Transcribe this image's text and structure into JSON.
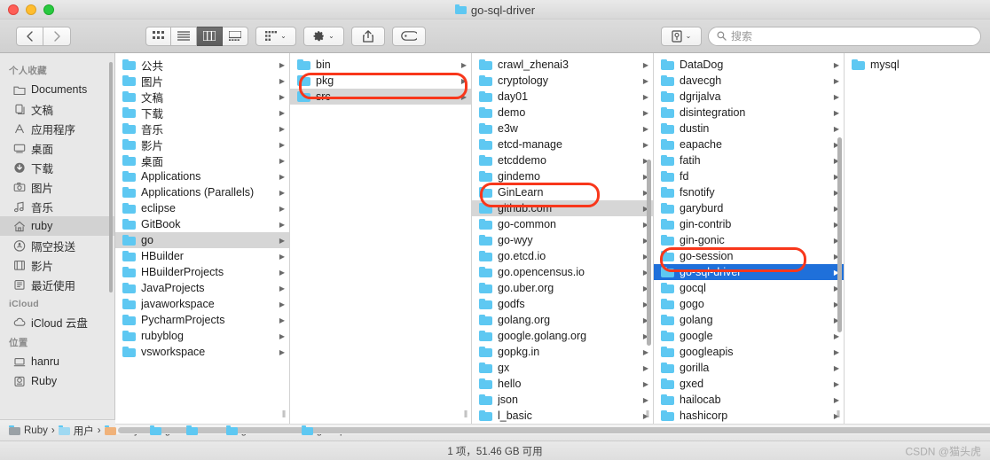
{
  "window": {
    "title": "go-sql-driver",
    "title_icon": "folder-icon"
  },
  "toolbar": {
    "back_label": "‹",
    "forward_label": "›",
    "view_icon_label": "icon-view-icon",
    "view_list_label": "list-view-icon",
    "view_column_label": "column-view-icon",
    "view_gallery_label": "gallery-view-icon",
    "arrange_label": "arrange-icon",
    "action_label": "gear-icon",
    "share_label": "share-icon",
    "tag_label": "tag-icon",
    "item_info_label": "item-info-icon",
    "chevron": "⌄",
    "search_placeholder": "搜索",
    "search_value": "",
    "active_view": "column"
  },
  "sidebar": {
    "sections": [
      {
        "header": "个人收藏",
        "items": [
          {
            "label": "Documents",
            "icon": "folder-icon",
            "selected": false
          },
          {
            "label": "文稿",
            "icon": "documents-icon",
            "selected": false
          },
          {
            "label": "应用程序",
            "icon": "applications-icon",
            "selected": false
          },
          {
            "label": "桌面",
            "icon": "desktop-icon",
            "selected": false
          },
          {
            "label": "下载",
            "icon": "downloads-icon",
            "selected": false
          },
          {
            "label": "图片",
            "icon": "pictures-icon",
            "selected": false
          },
          {
            "label": "音乐",
            "icon": "music-icon",
            "selected": false
          },
          {
            "label": "ruby",
            "icon": "home-icon",
            "selected": true
          },
          {
            "label": "隔空投送",
            "icon": "airdrop-icon",
            "selected": false
          },
          {
            "label": "影片",
            "icon": "movies-icon",
            "selected": false
          },
          {
            "label": "最近使用",
            "icon": "recents-icon",
            "selected": false
          }
        ]
      },
      {
        "header": "iCloud",
        "items": [
          {
            "label": "iCloud 云盘",
            "icon": "icloud-icon",
            "selected": false
          }
        ]
      },
      {
        "header": "位置",
        "items": [
          {
            "label": "hanru",
            "icon": "laptop-icon",
            "selected": false
          },
          {
            "label": "Ruby",
            "icon": "harddisk-icon",
            "selected": false
          }
        ]
      }
    ]
  },
  "columns": [
    {
      "name": "column-home",
      "items": [
        {
          "label": "公共",
          "icon": "public-folder-icon",
          "arrow": true,
          "state": "normal"
        },
        {
          "label": "图片",
          "icon": "pictures-folder-icon",
          "arrow": true,
          "state": "normal"
        },
        {
          "label": "文稿",
          "icon": "documents-folder-icon",
          "arrow": true,
          "state": "normal"
        },
        {
          "label": "下载",
          "icon": "downloads-folder-icon",
          "arrow": true,
          "state": "normal"
        },
        {
          "label": "音乐",
          "icon": "music-folder-icon",
          "arrow": true,
          "state": "normal"
        },
        {
          "label": "影片",
          "icon": "movies-folder-icon",
          "arrow": true,
          "state": "normal"
        },
        {
          "label": "桌面",
          "icon": "desktop-folder-icon",
          "arrow": true,
          "state": "normal"
        },
        {
          "label": "Applications",
          "icon": "applications-folder-icon",
          "arrow": true,
          "state": "normal"
        },
        {
          "label": "Applications (Parallels)",
          "icon": "parallels-folder-icon",
          "arrow": true,
          "state": "normal"
        },
        {
          "label": "eclipse",
          "icon": "folder-icon",
          "arrow": true,
          "state": "normal"
        },
        {
          "label": "GitBook",
          "icon": "folder-icon",
          "arrow": true,
          "state": "normal"
        },
        {
          "label": "go",
          "icon": "folder-icon",
          "arrow": true,
          "state": "grey"
        },
        {
          "label": "HBuilder",
          "icon": "folder-icon",
          "arrow": true,
          "state": "normal"
        },
        {
          "label": "HBuilderProjects",
          "icon": "folder-icon",
          "arrow": true,
          "state": "normal"
        },
        {
          "label": "JavaProjects",
          "icon": "folder-icon",
          "arrow": true,
          "state": "normal"
        },
        {
          "label": "javaworkspace",
          "icon": "folder-icon",
          "arrow": true,
          "state": "normal"
        },
        {
          "label": "PycharmProjects",
          "icon": "folder-icon",
          "arrow": true,
          "state": "normal"
        },
        {
          "label": "rubyblog",
          "icon": "folder-icon",
          "arrow": true,
          "state": "normal"
        },
        {
          "label": "vsworkspace",
          "icon": "folder-icon",
          "arrow": true,
          "state": "normal"
        }
      ]
    },
    {
      "name": "column-go",
      "items": [
        {
          "label": "bin",
          "icon": "folder-icon",
          "arrow": true,
          "state": "normal"
        },
        {
          "label": "pkg",
          "icon": "folder-icon",
          "arrow": true,
          "state": "normal"
        },
        {
          "label": "src",
          "icon": "folder-icon",
          "arrow": true,
          "state": "grey"
        }
      ]
    },
    {
      "name": "column-src",
      "items": [
        {
          "label": "crawl_zhenai3",
          "icon": "folder-icon",
          "arrow": true,
          "state": "normal"
        },
        {
          "label": "cryptology",
          "icon": "folder-icon",
          "arrow": true,
          "state": "normal"
        },
        {
          "label": "day01",
          "icon": "folder-icon",
          "arrow": true,
          "state": "normal"
        },
        {
          "label": "demo",
          "icon": "folder-icon",
          "arrow": true,
          "state": "normal"
        },
        {
          "label": "e3w",
          "icon": "folder-icon",
          "arrow": true,
          "state": "normal"
        },
        {
          "label": "etcd-manage",
          "icon": "folder-icon",
          "arrow": true,
          "state": "normal"
        },
        {
          "label": "etcddemo",
          "icon": "folder-icon",
          "arrow": true,
          "state": "normal"
        },
        {
          "label": "gindemo",
          "icon": "folder-icon",
          "arrow": true,
          "state": "normal"
        },
        {
          "label": "GinLearn",
          "icon": "folder-icon",
          "arrow": true,
          "state": "normal"
        },
        {
          "label": "github.com",
          "icon": "folder-icon",
          "arrow": true,
          "state": "grey"
        },
        {
          "label": "go-common",
          "icon": "folder-icon",
          "arrow": true,
          "state": "normal"
        },
        {
          "label": "go-wyy",
          "icon": "folder-icon",
          "arrow": true,
          "state": "normal"
        },
        {
          "label": "go.etcd.io",
          "icon": "folder-icon",
          "arrow": true,
          "state": "normal"
        },
        {
          "label": "go.opencensus.io",
          "icon": "folder-icon",
          "arrow": true,
          "state": "normal"
        },
        {
          "label": "go.uber.org",
          "icon": "folder-icon",
          "arrow": true,
          "state": "normal"
        },
        {
          "label": "godfs",
          "icon": "folder-icon",
          "arrow": true,
          "state": "normal"
        },
        {
          "label": "golang.org",
          "icon": "folder-icon",
          "arrow": true,
          "state": "normal"
        },
        {
          "label": "google.golang.org",
          "icon": "folder-icon",
          "arrow": true,
          "state": "normal"
        },
        {
          "label": "gopkg.in",
          "icon": "folder-icon",
          "arrow": true,
          "state": "normal"
        },
        {
          "label": "gx",
          "icon": "folder-icon",
          "arrow": true,
          "state": "normal"
        },
        {
          "label": "hello",
          "icon": "folder-icon",
          "arrow": true,
          "state": "normal"
        },
        {
          "label": "json",
          "icon": "folder-icon",
          "arrow": true,
          "state": "normal"
        },
        {
          "label": "l_basic",
          "icon": "folder-icon",
          "arrow": true,
          "state": "normal"
        }
      ]
    },
    {
      "name": "column-github-com",
      "items": [
        {
          "label": "DataDog",
          "icon": "folder-icon",
          "arrow": true,
          "state": "normal"
        },
        {
          "label": "davecgh",
          "icon": "folder-icon",
          "arrow": true,
          "state": "normal"
        },
        {
          "label": "dgrijalva",
          "icon": "folder-icon",
          "arrow": true,
          "state": "normal"
        },
        {
          "label": "disintegration",
          "icon": "folder-icon",
          "arrow": true,
          "state": "normal"
        },
        {
          "label": "dustin",
          "icon": "folder-icon",
          "arrow": true,
          "state": "normal"
        },
        {
          "label": "eapache",
          "icon": "folder-icon",
          "arrow": true,
          "state": "normal"
        },
        {
          "label": "fatih",
          "icon": "folder-icon",
          "arrow": true,
          "state": "normal"
        },
        {
          "label": "fd",
          "icon": "folder-icon",
          "arrow": true,
          "state": "normal"
        },
        {
          "label": "fsnotify",
          "icon": "folder-icon",
          "arrow": true,
          "state": "normal"
        },
        {
          "label": "garyburd",
          "icon": "folder-icon",
          "arrow": true,
          "state": "normal"
        },
        {
          "label": "gin-contrib",
          "icon": "folder-icon",
          "arrow": true,
          "state": "normal"
        },
        {
          "label": "gin-gonic",
          "icon": "folder-icon",
          "arrow": true,
          "state": "normal"
        },
        {
          "label": "go-session",
          "icon": "folder-icon",
          "arrow": true,
          "state": "normal"
        },
        {
          "label": "go-sql-driver",
          "icon": "folder-icon",
          "arrow": true,
          "state": "selected"
        },
        {
          "label": "gocql",
          "icon": "folder-icon",
          "arrow": true,
          "state": "normal"
        },
        {
          "label": "gogo",
          "icon": "folder-icon",
          "arrow": true,
          "state": "normal"
        },
        {
          "label": "golang",
          "icon": "folder-icon",
          "arrow": true,
          "state": "normal"
        },
        {
          "label": "google",
          "icon": "folder-icon",
          "arrow": true,
          "state": "normal"
        },
        {
          "label": "googleapis",
          "icon": "folder-icon",
          "arrow": true,
          "state": "normal"
        },
        {
          "label": "gorilla",
          "icon": "folder-icon",
          "arrow": true,
          "state": "normal"
        },
        {
          "label": "gxed",
          "icon": "folder-icon",
          "arrow": true,
          "state": "normal"
        },
        {
          "label": "hailocab",
          "icon": "folder-icon",
          "arrow": true,
          "state": "normal"
        },
        {
          "label": "hashicorp",
          "icon": "folder-icon",
          "arrow": true,
          "state": "normal"
        }
      ]
    },
    {
      "name": "column-go-sql-driver",
      "items": [
        {
          "label": "mysql",
          "icon": "folder-icon",
          "arrow": false,
          "state": "normal"
        }
      ]
    }
  ],
  "annotations": [
    {
      "name": "annotation-src",
      "color": "#f8371b"
    },
    {
      "name": "annotation-github-com",
      "color": "#f8371b"
    },
    {
      "name": "annotation-go-sql-driver",
      "color": "#f8371b"
    }
  ],
  "pathbar": {
    "crumbs": [
      {
        "label": "Ruby",
        "icon": "harddisk-icon"
      },
      {
        "label": "用户",
        "icon": "users-folder-icon"
      },
      {
        "label": "ruby",
        "icon": "home-folder-icon"
      },
      {
        "label": "go",
        "icon": "folder-icon"
      },
      {
        "label": "src",
        "icon": "folder-icon"
      },
      {
        "label": "github.com",
        "icon": "folder-icon"
      },
      {
        "label": "go-sql-driver",
        "icon": "folder-icon"
      }
    ],
    "separator": "›"
  },
  "statusbar": {
    "text": "1 项，51.46 GB 可用",
    "watermark": "CSDN @猫头虎"
  }
}
